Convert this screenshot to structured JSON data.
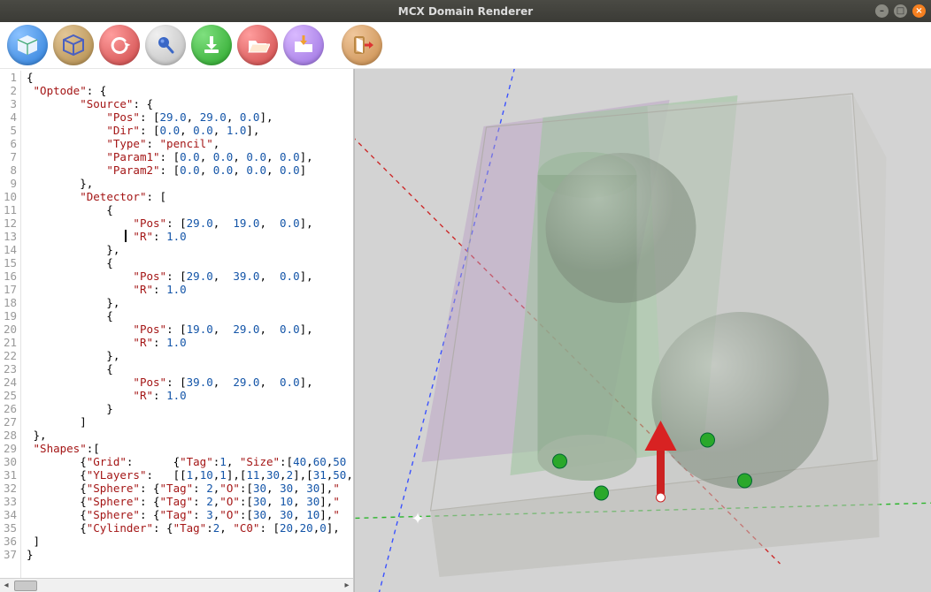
{
  "window": {
    "title": "MCX Domain Renderer",
    "buttons": {
      "min": "–",
      "max": "□",
      "close": "×"
    }
  },
  "toolbar": {
    "items": [
      {
        "name": "cube-filled-icon",
        "color": "blue"
      },
      {
        "name": "cube-outline-icon",
        "color": "olive"
      },
      {
        "name": "undo-icon",
        "color": "red"
      },
      {
        "name": "pin-icon",
        "color": "gray"
      },
      {
        "name": "download-icon",
        "color": "green"
      },
      {
        "name": "folder-open-icon",
        "color": "red"
      },
      {
        "name": "folder-download-icon",
        "color": "purp"
      },
      {
        "name": "exit-icon",
        "color": "oran"
      }
    ]
  },
  "editor": {
    "caret_line": 13,
    "lines": [
      [
        [
          "p",
          "{"
        ]
      ],
      [
        [
          "p",
          " "
        ],
        [
          "k",
          "\"Optode\""
        ],
        [
          "p",
          ": {"
        ]
      ],
      [
        [
          "p",
          "        "
        ],
        [
          "k",
          "\"Source\""
        ],
        [
          "p",
          ": {"
        ]
      ],
      [
        [
          "p",
          "            "
        ],
        [
          "k",
          "\"Pos\""
        ],
        [
          "p",
          ": ["
        ],
        [
          "n",
          "29.0"
        ],
        [
          "p",
          ", "
        ],
        [
          "n",
          "29.0"
        ],
        [
          "p",
          ", "
        ],
        [
          "n",
          "0.0"
        ],
        [
          "p",
          "],"
        ]
      ],
      [
        [
          "p",
          "            "
        ],
        [
          "k",
          "\"Dir\""
        ],
        [
          "p",
          ": ["
        ],
        [
          "n",
          "0.0"
        ],
        [
          "p",
          ", "
        ],
        [
          "n",
          "0.0"
        ],
        [
          "p",
          ", "
        ],
        [
          "n",
          "1.0"
        ],
        [
          "p",
          "],"
        ]
      ],
      [
        [
          "p",
          "            "
        ],
        [
          "k",
          "\"Type\""
        ],
        [
          "p",
          ": "
        ],
        [
          "k",
          "\"pencil\""
        ],
        [
          "p",
          ","
        ]
      ],
      [
        [
          "p",
          "            "
        ],
        [
          "k",
          "\"Param1\""
        ],
        [
          "p",
          ": ["
        ],
        [
          "n",
          "0.0"
        ],
        [
          "p",
          ", "
        ],
        [
          "n",
          "0.0"
        ],
        [
          "p",
          ", "
        ],
        [
          "n",
          "0.0"
        ],
        [
          "p",
          ", "
        ],
        [
          "n",
          "0.0"
        ],
        [
          "p",
          "],"
        ]
      ],
      [
        [
          "p",
          "            "
        ],
        [
          "k",
          "\"Param2\""
        ],
        [
          "p",
          ": ["
        ],
        [
          "n",
          "0.0"
        ],
        [
          "p",
          ", "
        ],
        [
          "n",
          "0.0"
        ],
        [
          "p",
          ", "
        ],
        [
          "n",
          "0.0"
        ],
        [
          "p",
          ", "
        ],
        [
          "n",
          "0.0"
        ],
        [
          "p",
          "]"
        ]
      ],
      [
        [
          "p",
          "        },"
        ]
      ],
      [
        [
          "p",
          "        "
        ],
        [
          "k",
          "\"Detector\""
        ],
        [
          "p",
          ": ["
        ]
      ],
      [
        [
          "p",
          "            {"
        ]
      ],
      [
        [
          "p",
          "                "
        ],
        [
          "k",
          "\"Pos\""
        ],
        [
          "p",
          ": ["
        ],
        [
          "n",
          "29.0"
        ],
        [
          "p",
          ",  "
        ],
        [
          "n",
          "19.0"
        ],
        [
          "p",
          ",  "
        ],
        [
          "n",
          "0.0"
        ],
        [
          "p",
          "],"
        ]
      ],
      [
        [
          "p",
          "                "
        ],
        [
          "k",
          "\"R\""
        ],
        [
          "p",
          ": "
        ],
        [
          "n",
          "1.0"
        ]
      ],
      [
        [
          "p",
          "            },"
        ]
      ],
      [
        [
          "p",
          "            {"
        ]
      ],
      [
        [
          "p",
          "                "
        ],
        [
          "k",
          "\"Pos\""
        ],
        [
          "p",
          ": ["
        ],
        [
          "n",
          "29.0"
        ],
        [
          "p",
          ",  "
        ],
        [
          "n",
          "39.0"
        ],
        [
          "p",
          ",  "
        ],
        [
          "n",
          "0.0"
        ],
        [
          "p",
          "],"
        ]
      ],
      [
        [
          "p",
          "                "
        ],
        [
          "k",
          "\"R\""
        ],
        [
          "p",
          ": "
        ],
        [
          "n",
          "1.0"
        ]
      ],
      [
        [
          "p",
          "            },"
        ]
      ],
      [
        [
          "p",
          "            {"
        ]
      ],
      [
        [
          "p",
          "                "
        ],
        [
          "k",
          "\"Pos\""
        ],
        [
          "p",
          ": ["
        ],
        [
          "n",
          "19.0"
        ],
        [
          "p",
          ",  "
        ],
        [
          "n",
          "29.0"
        ],
        [
          "p",
          ",  "
        ],
        [
          "n",
          "0.0"
        ],
        [
          "p",
          "],"
        ]
      ],
      [
        [
          "p",
          "                "
        ],
        [
          "k",
          "\"R\""
        ],
        [
          "p",
          ": "
        ],
        [
          "n",
          "1.0"
        ]
      ],
      [
        [
          "p",
          "            },"
        ]
      ],
      [
        [
          "p",
          "            {"
        ]
      ],
      [
        [
          "p",
          "                "
        ],
        [
          "k",
          "\"Pos\""
        ],
        [
          "p",
          ": ["
        ],
        [
          "n",
          "39.0"
        ],
        [
          "p",
          ",  "
        ],
        [
          "n",
          "29.0"
        ],
        [
          "p",
          ",  "
        ],
        [
          "n",
          "0.0"
        ],
        [
          "p",
          "],"
        ]
      ],
      [
        [
          "p",
          "                "
        ],
        [
          "k",
          "\"R\""
        ],
        [
          "p",
          ": "
        ],
        [
          "n",
          "1.0"
        ]
      ],
      [
        [
          "p",
          "            }"
        ]
      ],
      [
        [
          "p",
          "        ]"
        ]
      ],
      [
        [
          "p",
          " },"
        ]
      ],
      [
        [
          "p",
          " "
        ],
        [
          "k",
          "\"Shapes\""
        ],
        [
          "p",
          ":["
        ]
      ],
      [
        [
          "p",
          "        {"
        ],
        [
          "k",
          "\"Grid\""
        ],
        [
          "p",
          ":      {"
        ],
        [
          "k",
          "\"Tag\""
        ],
        [
          "p",
          ":"
        ],
        [
          "n",
          "1"
        ],
        [
          "p",
          ", "
        ],
        [
          "k",
          "\"Size\""
        ],
        [
          "p",
          ":["
        ],
        [
          "n",
          "40"
        ],
        [
          "p",
          ","
        ],
        [
          "n",
          "60"
        ],
        [
          "p",
          ","
        ],
        [
          "n",
          "50"
        ]
      ],
      [
        [
          "p",
          "        {"
        ],
        [
          "k",
          "\"YLayers\""
        ],
        [
          "p",
          ":   [["
        ],
        [
          "n",
          "1"
        ],
        [
          "p",
          ","
        ],
        [
          "n",
          "10"
        ],
        [
          "p",
          ","
        ],
        [
          "n",
          "1"
        ],
        [
          "p",
          "],["
        ],
        [
          "n",
          "11"
        ],
        [
          "p",
          ","
        ],
        [
          "n",
          "30"
        ],
        [
          "p",
          ","
        ],
        [
          "n",
          "2"
        ],
        [
          "p",
          "],["
        ],
        [
          "n",
          "31"
        ],
        [
          "p",
          ","
        ],
        [
          "n",
          "50"
        ],
        [
          "p",
          ","
        ]
      ],
      [
        [
          "p",
          "        {"
        ],
        [
          "k",
          "\"Sphere\""
        ],
        [
          "p",
          ": {"
        ],
        [
          "k",
          "\"Tag\""
        ],
        [
          "p",
          ": "
        ],
        [
          "n",
          "2"
        ],
        [
          "p",
          ","
        ],
        [
          "k",
          "\"O\""
        ],
        [
          "p",
          ":["
        ],
        [
          "n",
          "30"
        ],
        [
          "p",
          ", "
        ],
        [
          "n",
          "30"
        ],
        [
          "p",
          ", "
        ],
        [
          "n",
          "30"
        ],
        [
          "p",
          "],"
        ],
        [
          "k",
          "\""
        ]
      ],
      [
        [
          "p",
          "        {"
        ],
        [
          "k",
          "\"Sphere\""
        ],
        [
          "p",
          ": {"
        ],
        [
          "k",
          "\"Tag\""
        ],
        [
          "p",
          ": "
        ],
        [
          "n",
          "2"
        ],
        [
          "p",
          ","
        ],
        [
          "k",
          "\"O\""
        ],
        [
          "p",
          ":["
        ],
        [
          "n",
          "30"
        ],
        [
          "p",
          ", "
        ],
        [
          "n",
          "10"
        ],
        [
          "p",
          ", "
        ],
        [
          "n",
          "30"
        ],
        [
          "p",
          "],"
        ],
        [
          "k",
          "\""
        ]
      ],
      [
        [
          "p",
          "        {"
        ],
        [
          "k",
          "\"Sphere\""
        ],
        [
          "p",
          ": {"
        ],
        [
          "k",
          "\"Tag\""
        ],
        [
          "p",
          ": "
        ],
        [
          "n",
          "3"
        ],
        [
          "p",
          ","
        ],
        [
          "k",
          "\"O\""
        ],
        [
          "p",
          ":["
        ],
        [
          "n",
          "30"
        ],
        [
          "p",
          ", "
        ],
        [
          "n",
          "30"
        ],
        [
          "p",
          ", "
        ],
        [
          "n",
          "10"
        ],
        [
          "p",
          "],"
        ],
        [
          "k",
          "\""
        ]
      ],
      [
        [
          "p",
          "        {"
        ],
        [
          "k",
          "\"Cylinder\""
        ],
        [
          "p",
          ": {"
        ],
        [
          "k",
          "\"Tag\""
        ],
        [
          "p",
          ":"
        ],
        [
          "n",
          "2"
        ],
        [
          "p",
          ", "
        ],
        [
          "k",
          "\"C0\""
        ],
        [
          "p",
          ": ["
        ],
        [
          "n",
          "20"
        ],
        [
          "p",
          ","
        ],
        [
          "n",
          "20"
        ],
        [
          "p",
          ","
        ],
        [
          "n",
          "0"
        ],
        [
          "p",
          "],"
        ]
      ],
      [
        [
          "p",
          " ]"
        ]
      ],
      [
        [
          "p",
          "}"
        ]
      ]
    ]
  },
  "scene": {
    "origin_label": "✦"
  }
}
